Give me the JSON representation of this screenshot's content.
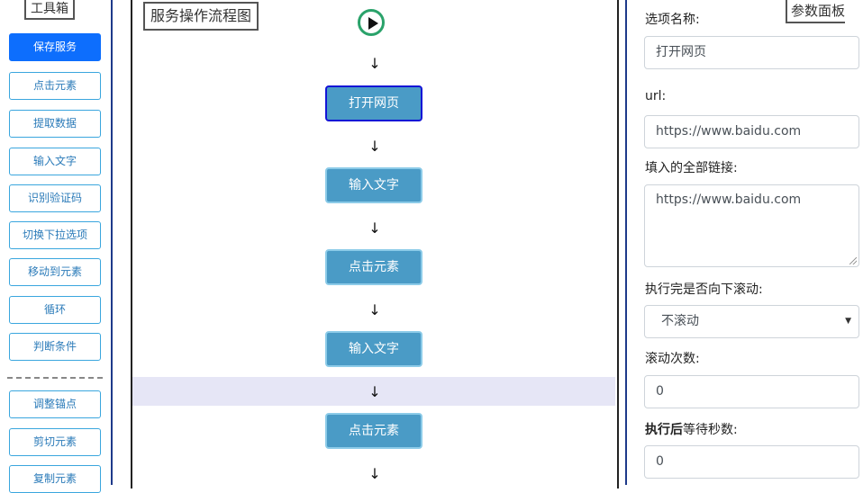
{
  "toolbox": {
    "title": "工具箱",
    "buttons": [
      "保存服务",
      "点击元素",
      "提取数据",
      "输入文字",
      "识别验证码",
      "切换下拉选项",
      "移动到元素",
      "循环",
      "判断条件"
    ],
    "buttons_below": [
      "调整锚点",
      "剪切元素",
      "复制元素"
    ]
  },
  "flow": {
    "title": "服务操作流程图",
    "arrow": "↓",
    "nodes": [
      "打开网页",
      "输入文字",
      "点击元素",
      "输入文字",
      "点击元素"
    ],
    "selected_node": "打开网页"
  },
  "params": {
    "title": "参数面板",
    "option_name_label": "选项名称:",
    "option_name_value": "打开网页",
    "url_label": "url:",
    "url_value": "https://www.baidu.com",
    "links_label": "填入的全部链接:",
    "links_value": "https://www.baidu.com",
    "scroll_label": "执行完是否向下滚动:",
    "scroll_value": "不滚动",
    "scroll_count_label": "滚动次数:",
    "scroll_count_value": "0",
    "wait_label_bold": "执行后",
    "wait_label_rest": "等待秒数:",
    "wait_value": "0"
  },
  "colors": {
    "primary": "#0d6efd",
    "node": "#4a9bc6",
    "selected_border": "#1414d6",
    "start": "#2aa26a"
  }
}
